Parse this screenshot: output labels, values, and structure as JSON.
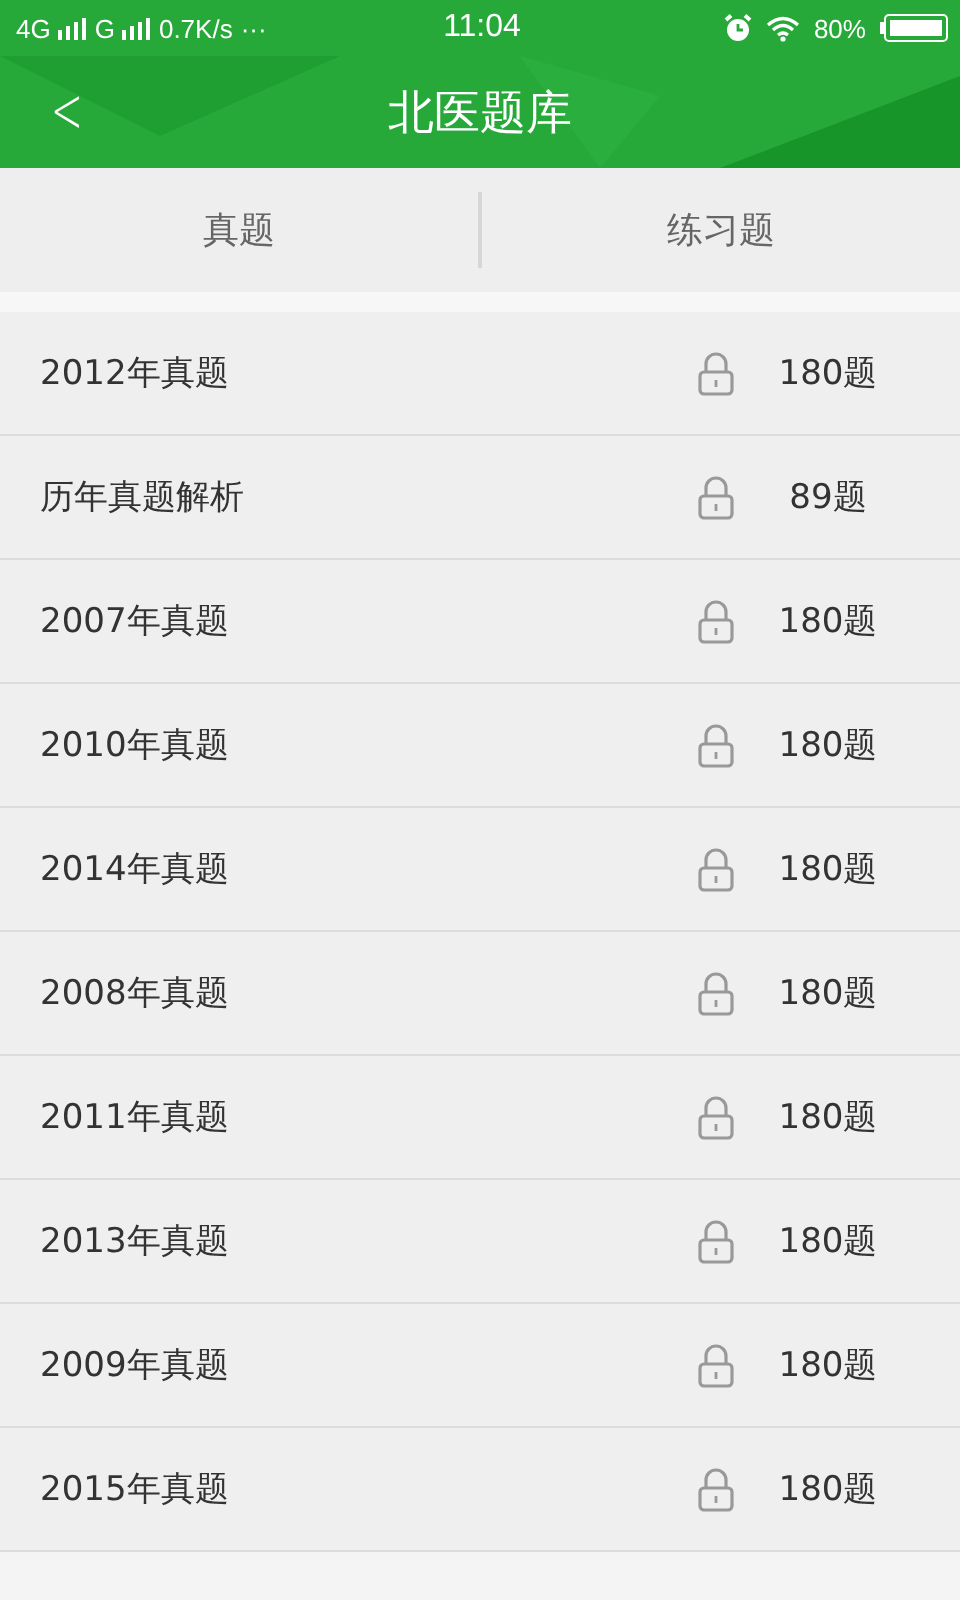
{
  "status_bar": {
    "network_1": "4G",
    "network_2": "G",
    "speed": "0.7K/s",
    "more": "···",
    "time": "11:04",
    "battery": "80%"
  },
  "header": {
    "back": "<",
    "title": "北医题库"
  },
  "tabs": [
    {
      "label": "真题",
      "selected": false
    },
    {
      "label": "练习题",
      "selected": false
    }
  ],
  "items": [
    {
      "name": "2012年真题",
      "locked": true,
      "count": "180题"
    },
    {
      "name": "历年真题解析",
      "locked": true,
      "count": "89题"
    },
    {
      "name": "2007年真题",
      "locked": true,
      "count": "180题"
    },
    {
      "name": "2010年真题",
      "locked": true,
      "count": "180题"
    },
    {
      "name": "2014年真题",
      "locked": true,
      "count": "180题"
    },
    {
      "name": "2008年真题",
      "locked": true,
      "count": "180题"
    },
    {
      "name": "2011年真题",
      "locked": true,
      "count": "180题"
    },
    {
      "name": "2013年真题",
      "locked": true,
      "count": "180题"
    },
    {
      "name": "2009年真题",
      "locked": true,
      "count": "180题"
    },
    {
      "name": "2015年真题",
      "locked": true,
      "count": "180题"
    }
  ]
}
